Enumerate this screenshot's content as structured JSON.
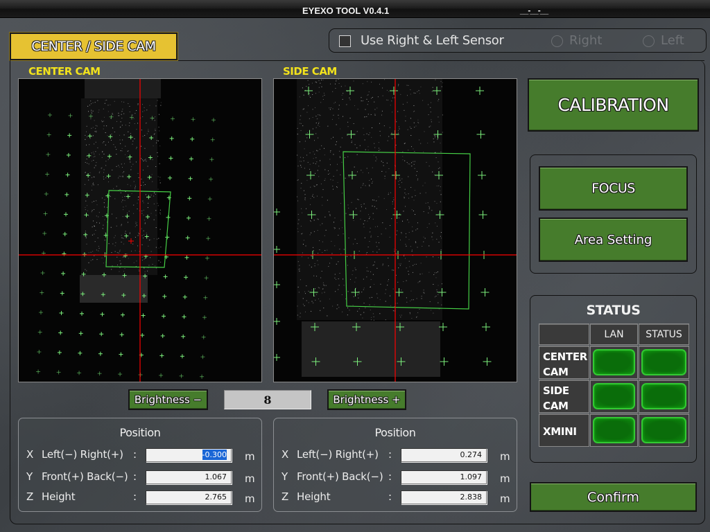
{
  "window": {
    "title": "EYEXO TOOL V0.4.1",
    "controls": "__-__-__"
  },
  "tabs": {
    "active_label": "CENTER / SIDE CAM"
  },
  "sensor": {
    "checkbox_label": "Use Right & Left  Sensor",
    "checked": false,
    "radio_right_label": "Right",
    "radio_left_label": "Left",
    "radios_enabled": false
  },
  "center_cam": {
    "label": "CENTER CAM",
    "position": {
      "title": "Position",
      "rows": [
        {
          "axis": "X",
          "desc": "Left(−) Right(+)",
          "colon": ":",
          "value": "-0.300",
          "unit": "m",
          "selected": true
        },
        {
          "axis": "Y",
          "desc": "Front(+) Back(−)",
          "colon": ":",
          "value": "1.067",
          "unit": "m"
        },
        {
          "axis": "Z",
          "desc": "Height",
          "colon": ":",
          "value": "2.765",
          "unit": "m"
        }
      ]
    }
  },
  "side_cam": {
    "label": "SIDE CAM",
    "position": {
      "title": "Position",
      "rows": [
        {
          "axis": "X",
          "desc": "Left(−) Right(+)",
          "colon": ":",
          "value": "0.274",
          "unit": "m"
        },
        {
          "axis": "Y",
          "desc": "Front(+) Back(−)",
          "colon": ":",
          "value": "1.097",
          "unit": "m"
        },
        {
          "axis": "Z",
          "desc": "Height",
          "colon": ":",
          "value": "2.838",
          "unit": "m"
        }
      ]
    }
  },
  "brightness": {
    "minus_label": "Brightness −",
    "plus_label": "Brightness +",
    "value": "8"
  },
  "actions": {
    "calibration_label": "CALIBRATION",
    "focus_label": "FOCUS",
    "area_setting_label": "Area Setting",
    "confirm_label": "Confirm"
  },
  "status": {
    "title": "STATUS",
    "columns": [
      "LAN",
      "STATUS"
    ],
    "rows": [
      {
        "label_line1": "CENTER",
        "label_line2": "CAM",
        "lan": "ok",
        "status": "ok"
      },
      {
        "label_line1": "SIDE",
        "label_line2": "CAM",
        "lan": "ok",
        "status": "ok"
      },
      {
        "label_line1": "XMINI",
        "label_line2": "",
        "lan": "ok",
        "status": "ok"
      }
    ],
    "ok_color": "#0a7a0a"
  },
  "colors": {
    "tab_active": "#e6c232",
    "button_green": "#467c2c",
    "cam_label": "#f2e21c",
    "crosshair": "#ff0000",
    "marker": "#7cf07c"
  }
}
